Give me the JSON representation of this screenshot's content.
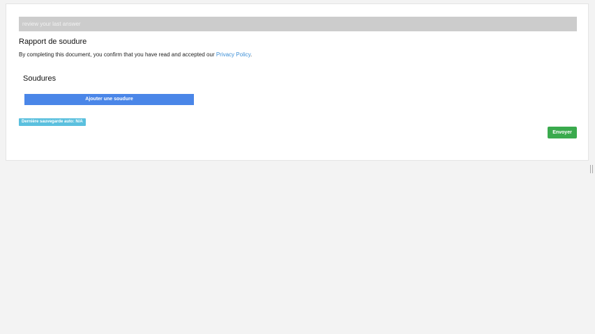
{
  "review_bar": {
    "text": "review your last answer"
  },
  "form": {
    "title": "Rapport de soudure",
    "consent_prefix": "By completing this document, you confirm that you have read and accepted our ",
    "privacy_link": "Privacy Policy",
    "consent_suffix": "."
  },
  "section": {
    "title": "Soudures",
    "add_button": "Ajouter une soudure"
  },
  "autosave": {
    "label": "Dernière sauvegarde auto: N/A"
  },
  "actions": {
    "send_button": "Envoyer"
  },
  "colors": {
    "review_bar": "#cccccc",
    "link": "#3d8fd6",
    "add_button": "#4a86e8",
    "autosave_badge": "#5bc0de",
    "send_button": "#3aaa4d",
    "page_background": "#f3f3f3"
  }
}
